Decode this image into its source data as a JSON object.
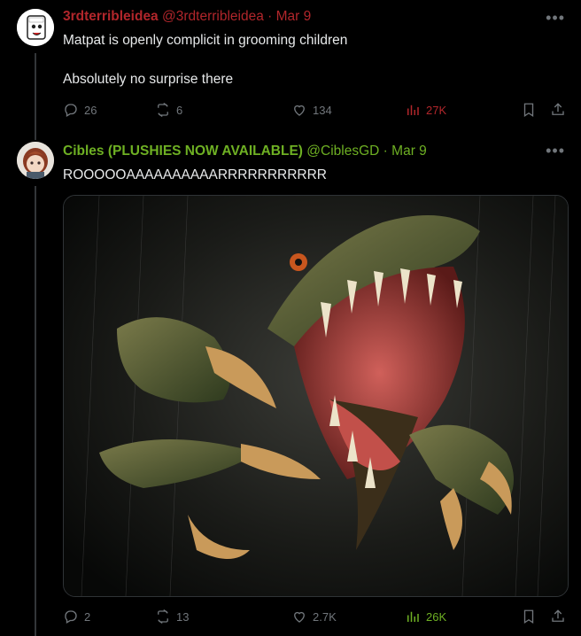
{
  "tweets": [
    {
      "name": "3rdterribleidea",
      "handle": "@3rdterribleidea",
      "dot": "·",
      "date": "Mar 9",
      "text_lines": [
        "Matpat is openly complicit in grooming children",
        "Absolutely no surprise there"
      ],
      "replies": "26",
      "retweets": "6",
      "likes": "134",
      "views": "27K",
      "accent": "#b1262b"
    },
    {
      "name": "Cibles (PLUSHIES NOW AVAILABLE)",
      "handle": "@CiblesGD",
      "dot": "·",
      "date": "Mar 9",
      "text_lines": [
        "ROOOOOAAAAAAAAAARRRRRRRRRRR"
      ],
      "replies": "2",
      "retweets": "13",
      "likes": "2.7K",
      "views": "26K",
      "accent": "#6eb023"
    }
  ],
  "icons": {
    "more": "more-icon",
    "reply": "reply-icon",
    "retweet": "retweet-icon",
    "like": "heart-icon",
    "views": "bar-chart-icon",
    "bookmark": "bookmark-icon",
    "share": "share-icon"
  }
}
